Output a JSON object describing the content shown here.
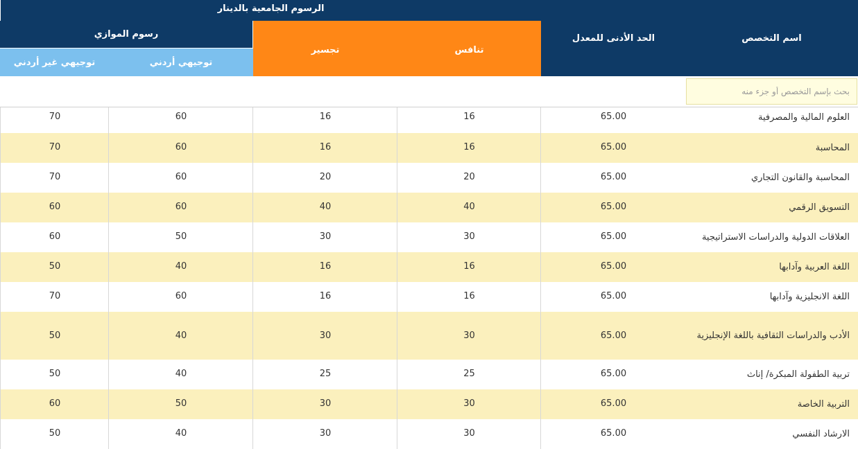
{
  "header": {
    "group_fees": "الرسوم الجامعية بالدينار",
    "min_average": "الحد الأدنى للمعدل",
    "major_name": "اسم التخصص",
    "competition": "تنافس",
    "bridging": "تجسير",
    "parallel_fees": "رسوم الموازي",
    "tawjihi_jordanian": "توجيهي أردني",
    "tawjihi_non_jordanian": "توجيهي غير أردني"
  },
  "search": {
    "placeholder": "بحث بإسم التخصص أو جزء منه"
  },
  "colors": {
    "header_dark": "#0e3a66",
    "header_orange": "#ff8716",
    "header_light": "#7cc0ee",
    "row_alt": "#fbf0bd"
  },
  "rows": [
    {
      "name": "العلوم المالية والمصرفية",
      "min_avg": "65.00",
      "competition": "16",
      "bridging": "16",
      "parallel_jo": "60",
      "parallel_non_jo": "70"
    },
    {
      "name": "المحاسبة",
      "min_avg": "65.00",
      "competition": "16",
      "bridging": "16",
      "parallel_jo": "60",
      "parallel_non_jo": "70"
    },
    {
      "name": "المحاسبة والقانون التجاري",
      "min_avg": "65.00",
      "competition": "20",
      "bridging": "20",
      "parallel_jo": "60",
      "parallel_non_jo": "70"
    },
    {
      "name": "التسويق الرقمي",
      "min_avg": "65.00",
      "competition": "40",
      "bridging": "40",
      "parallel_jo": "60",
      "parallel_non_jo": "60"
    },
    {
      "name": "العلاقات الدولية والدراسات الاستراتيجية",
      "min_avg": "65.00",
      "competition": "30",
      "bridging": "30",
      "parallel_jo": "50",
      "parallel_non_jo": "60"
    },
    {
      "name": "اللغة العربية وآدابها",
      "min_avg": "65.00",
      "competition": "16",
      "bridging": "16",
      "parallel_jo": "40",
      "parallel_non_jo": "50"
    },
    {
      "name": "اللغة الانجليزية وآدابها",
      "min_avg": "65.00",
      "competition": "16",
      "bridging": "16",
      "parallel_jo": "60",
      "parallel_non_jo": "70"
    },
    {
      "name": "الأدب والدراسات الثقافية باللغة الإنجليزية",
      "min_avg": "65.00",
      "competition": "30",
      "bridging": "30",
      "parallel_jo": "40",
      "parallel_non_jo": "50"
    },
    {
      "name": "تربية الطفولة المبكرة/ إناث",
      "min_avg": "65.00",
      "competition": "25",
      "bridging": "25",
      "parallel_jo": "40",
      "parallel_non_jo": "50"
    },
    {
      "name": "التربية الخاصة",
      "min_avg": "65.00",
      "competition": "30",
      "bridging": "30",
      "parallel_jo": "50",
      "parallel_non_jo": "60"
    },
    {
      "name": "الارشاد النفسي",
      "min_avg": "65.00",
      "competition": "30",
      "bridging": "30",
      "parallel_jo": "40",
      "parallel_non_jo": "50"
    }
  ]
}
